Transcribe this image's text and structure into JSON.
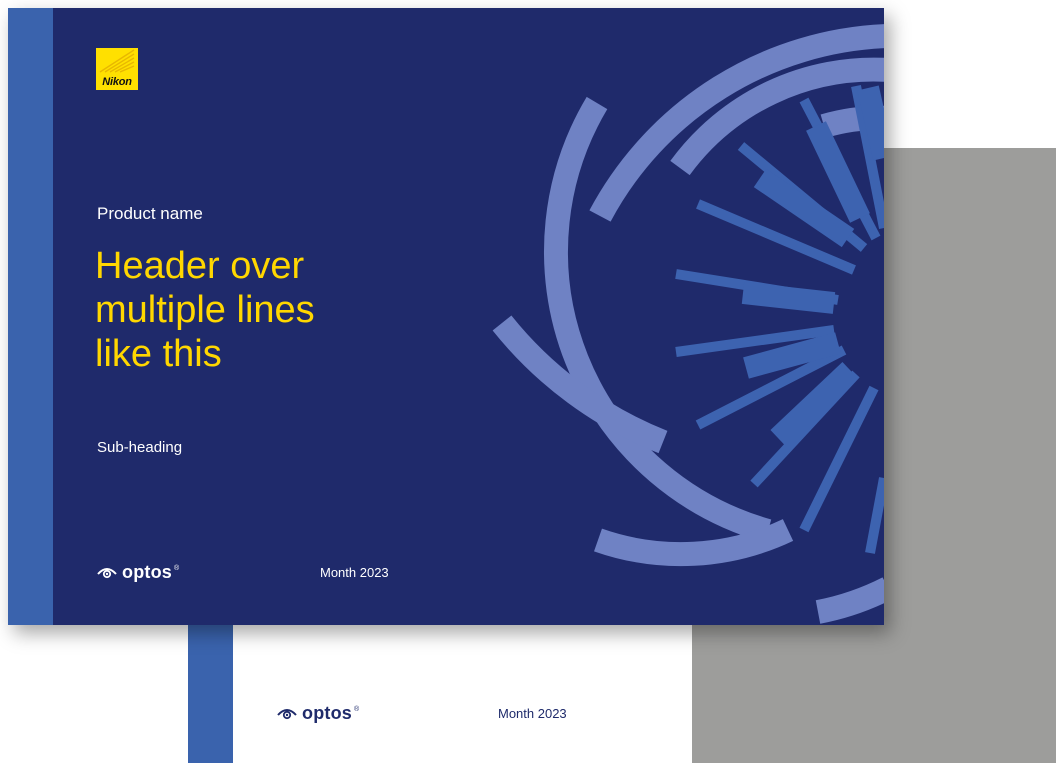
{
  "cover": {
    "brand_mark": "Nikon",
    "product_name": "Product name",
    "header_lines": [
      "Header over",
      "multiple lines",
      "like this"
    ],
    "sub_heading": "Sub-heading",
    "logo_text": "optos",
    "logo_reg": "®",
    "date": "Month 2023"
  },
  "back_page": {
    "logo_text": "optos",
    "logo_reg": "®",
    "date": "Month 2023"
  },
  "icons": {
    "brand": "nikon-logo-icon",
    "eye": "optos-eye-icon"
  },
  "colors": {
    "navy": "#1f2a6b",
    "band_blue": "#3a63ad",
    "arc_light": "#6f82c4",
    "ray_blue": "#3d63b0",
    "yellow": "#ffd700",
    "grey": "#9d9d9b"
  }
}
